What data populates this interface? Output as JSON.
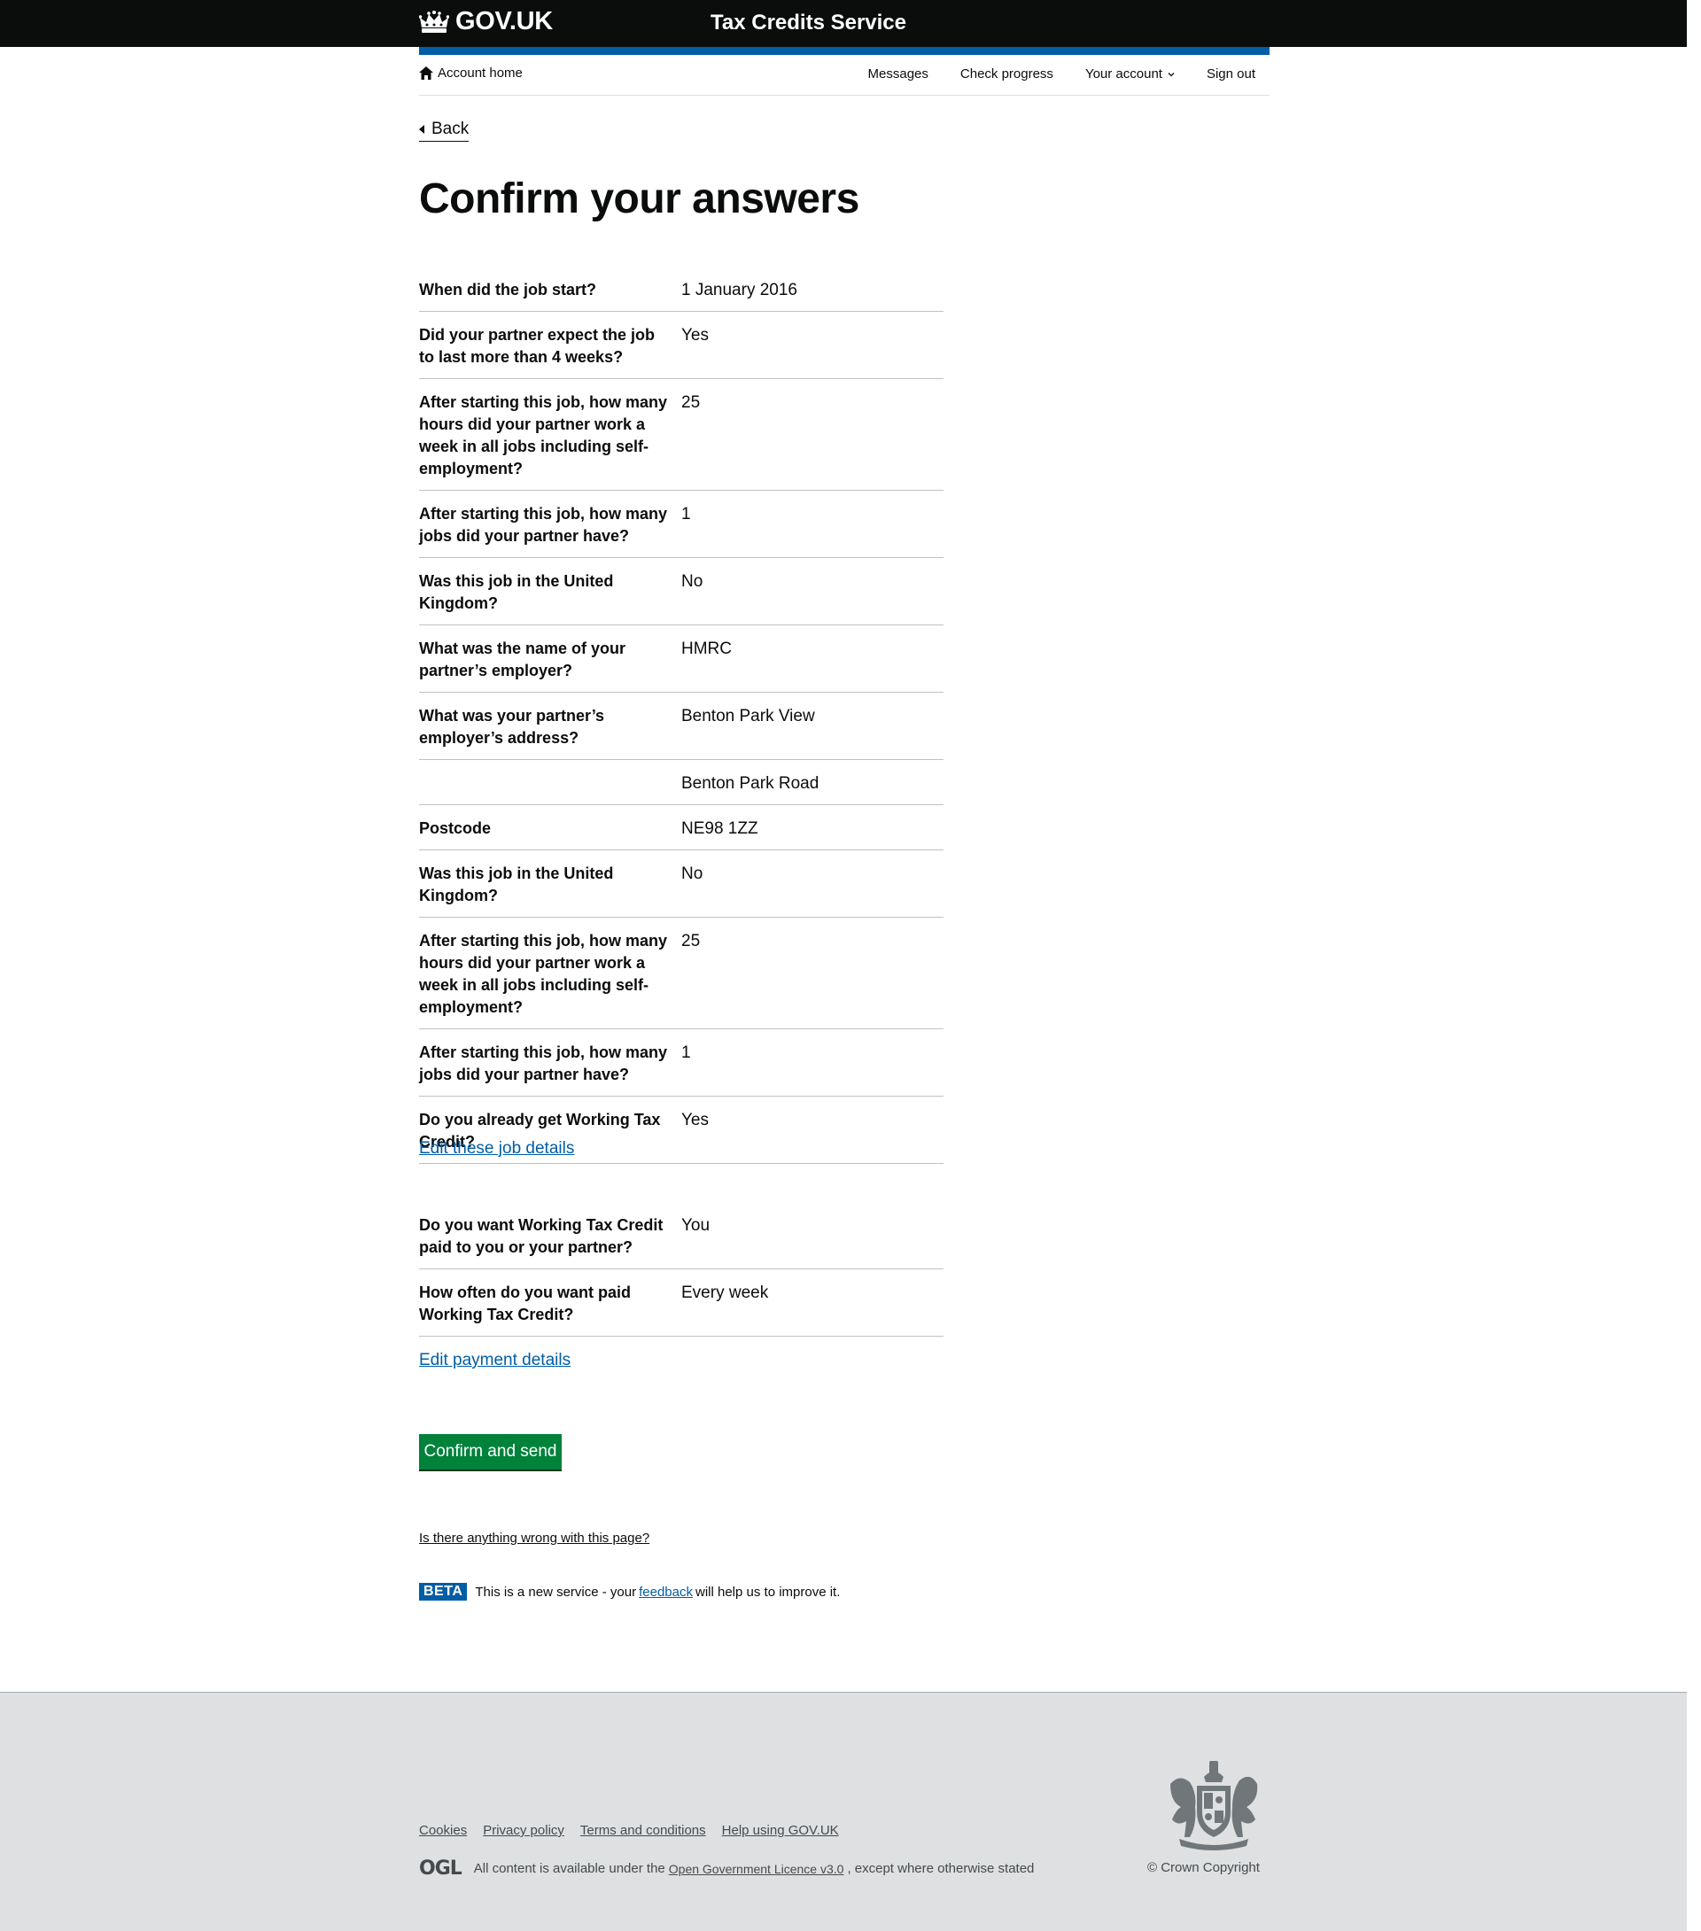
{
  "header": {
    "logo_text": "GOV.UK",
    "service_name": "Tax Credits Service"
  },
  "account_nav": {
    "home_label": "Account home",
    "links": [
      "Messages",
      "Check progress",
      "Your account",
      "Sign out"
    ]
  },
  "back_label": "Back",
  "page_title": "Confirm your answers",
  "job_rows": [
    {
      "key": "When did the job start?",
      "value": "1 January 2016"
    },
    {
      "key": "Did your partner expect the job to last more than 4 weeks?",
      "value": "Yes"
    },
    {
      "key": "After starting this job, how many hours did your partner work a week in all jobs including self-employment?",
      "value": "25"
    },
    {
      "key": "After starting this job, how many jobs did your partner have?",
      "value": "1"
    },
    {
      "key": "Was this job in the United Kingdom?",
      "value": "No"
    },
    {
      "key": "What was the name of your partner’s employer?",
      "value": "HMRC"
    },
    {
      "key": "What was your partner’s employer’s address?",
      "value": "Benton Park View"
    },
    {
      "key": "",
      "value": "Benton Park Road"
    },
    {
      "key": "Postcode",
      "value": "NE98 1ZZ"
    },
    {
      "key": "Was this job in the United Kingdom?",
      "value": "No"
    },
    {
      "key": "After starting this job, how many hours did your partner work a week in all jobs including self-employment?",
      "value": "25"
    },
    {
      "key": "After starting this job, how many jobs did your partner have?",
      "value": "1"
    },
    {
      "key": "Do you already get Working Tax Credit?",
      "value": "Yes"
    }
  ],
  "edit_job_label": "Edit these job details",
  "payment_rows": [
    {
      "key": "Do you want Working Tax Credit paid to you or your partner?",
      "value": "You"
    },
    {
      "key": "How often do you want paid Working Tax Credit?",
      "value": "Every week"
    }
  ],
  "edit_payment_label": "Edit payment details",
  "submit_label": "Confirm and send",
  "report_problem_label": "Is there anything wrong with this page?",
  "beta": {
    "tag": "BETA",
    "text_before": "This is a new service  - your",
    "link": "feedback",
    "text_after": "will help us to improve it."
  },
  "footer": {
    "links": [
      "Cookies",
      "Privacy policy",
      "Terms and conditions",
      "Help using GOV.UK"
    ],
    "ogl_logo": "OGL",
    "licence_before": "All content is available under the",
    "licence_link": "Open Government Licence v3.0",
    "licence_after": ", except where otherwise stated",
    "copyright": "© Crown Copyright"
  },
  "colors": {
    "header_bg": "#0b0c0c",
    "accent_bar": "#005ea5",
    "link": "#005ea5",
    "button": "#00823b",
    "footer_bg": "#dee0e2"
  }
}
